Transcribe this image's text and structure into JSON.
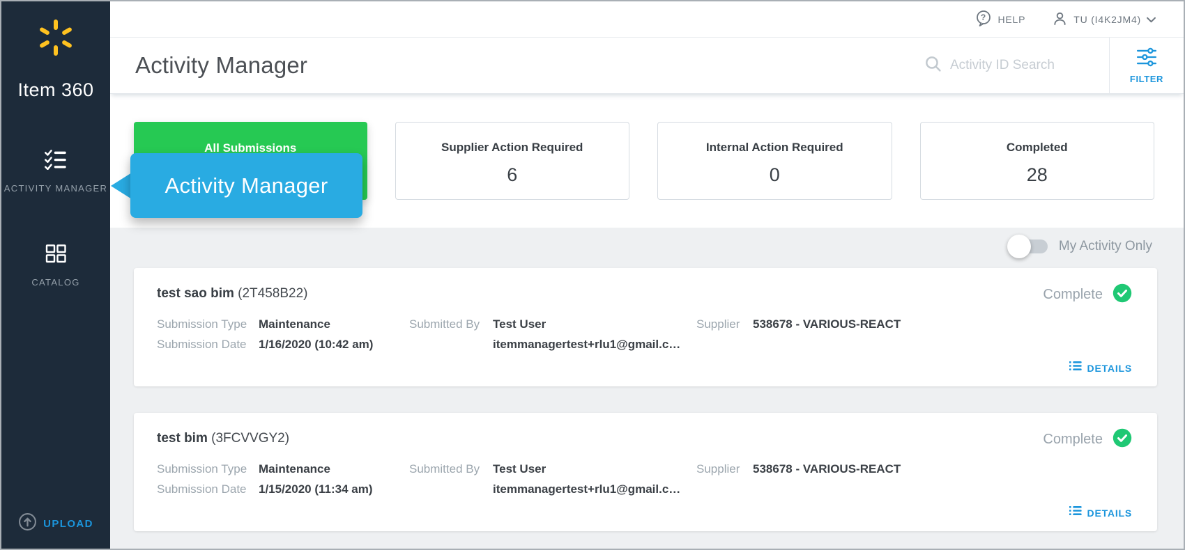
{
  "sidebar": {
    "brand": "Item 360",
    "nav": [
      {
        "label": "ACTIVITY MANAGER",
        "icon": "checklist-icon",
        "active": true
      },
      {
        "label": "CATALOG",
        "icon": "grid-icon",
        "active": false
      }
    ],
    "upload_label": "UPLOAD"
  },
  "topbar": {
    "help_label": "HELP",
    "user_label": "TU (I4K2JM4)"
  },
  "header": {
    "title": "Activity Manager",
    "search_placeholder": "Activity ID Search",
    "filter_label": "FILTER"
  },
  "stats": [
    {
      "label": "All Submissions",
      "value": "",
      "active": true
    },
    {
      "label": "Supplier Action Required",
      "value": "6"
    },
    {
      "label": "Internal Action Required",
      "value": "0"
    },
    {
      "label": "Completed",
      "value": "28"
    }
  ],
  "tooltip": {
    "text": "Activity Manager"
  },
  "toolbar": {
    "my_activity_label": "My Activity Only",
    "toggle_state": "off"
  },
  "card_labels": {
    "submission_type": "Submission Type",
    "submission_date": "Submission Date",
    "submitted_by": "Submitted By",
    "supplier": "Supplier",
    "details": "DETAILS"
  },
  "activities": [
    {
      "name": "test sao bim",
      "id": "(2T458B22)",
      "submission_type": "Maintenance",
      "submission_date": "1/16/2020 (10:42 am)",
      "submitted_by": "Test User",
      "submitted_by_email": "itemmanagertest+rlu1@gmail.c…",
      "supplier": "538678 - VARIOUS-REACT",
      "status": "Complete"
    },
    {
      "name": "test bim",
      "id": "(3FCVVGY2)",
      "submission_type": "Maintenance",
      "submission_date": "1/15/2020 (11:34 am)",
      "submitted_by": "Test User",
      "submitted_by_email": "itemmanagertest+rlu1@gmail.c…",
      "supplier": "538678 - VARIOUS-REACT",
      "status": "Complete"
    }
  ],
  "icons": {
    "walmart-spark-icon": "six yellow spark petals",
    "checklist-icon": "checked list",
    "grid-icon": "2x2 squares",
    "upload-icon": "arrow up in circle",
    "help-icon": "question speech bubble",
    "user-icon": "person silhouette",
    "chevron-down-icon": "v",
    "search-icon": "magnifier",
    "filter-icon": "slider tune lines",
    "details-list-icon": "dotted list",
    "check-circle-icon": "white check on green circle"
  },
  "colors": {
    "sidebar_navy": "#1d2b3a",
    "spark_yellow": "#ffc220",
    "active_green": "#26c953",
    "tooltip_blue": "#29abe2",
    "link_blue": "#1b95dc",
    "check_green": "#1fc874",
    "gray_bg": "#eef0f2"
  }
}
